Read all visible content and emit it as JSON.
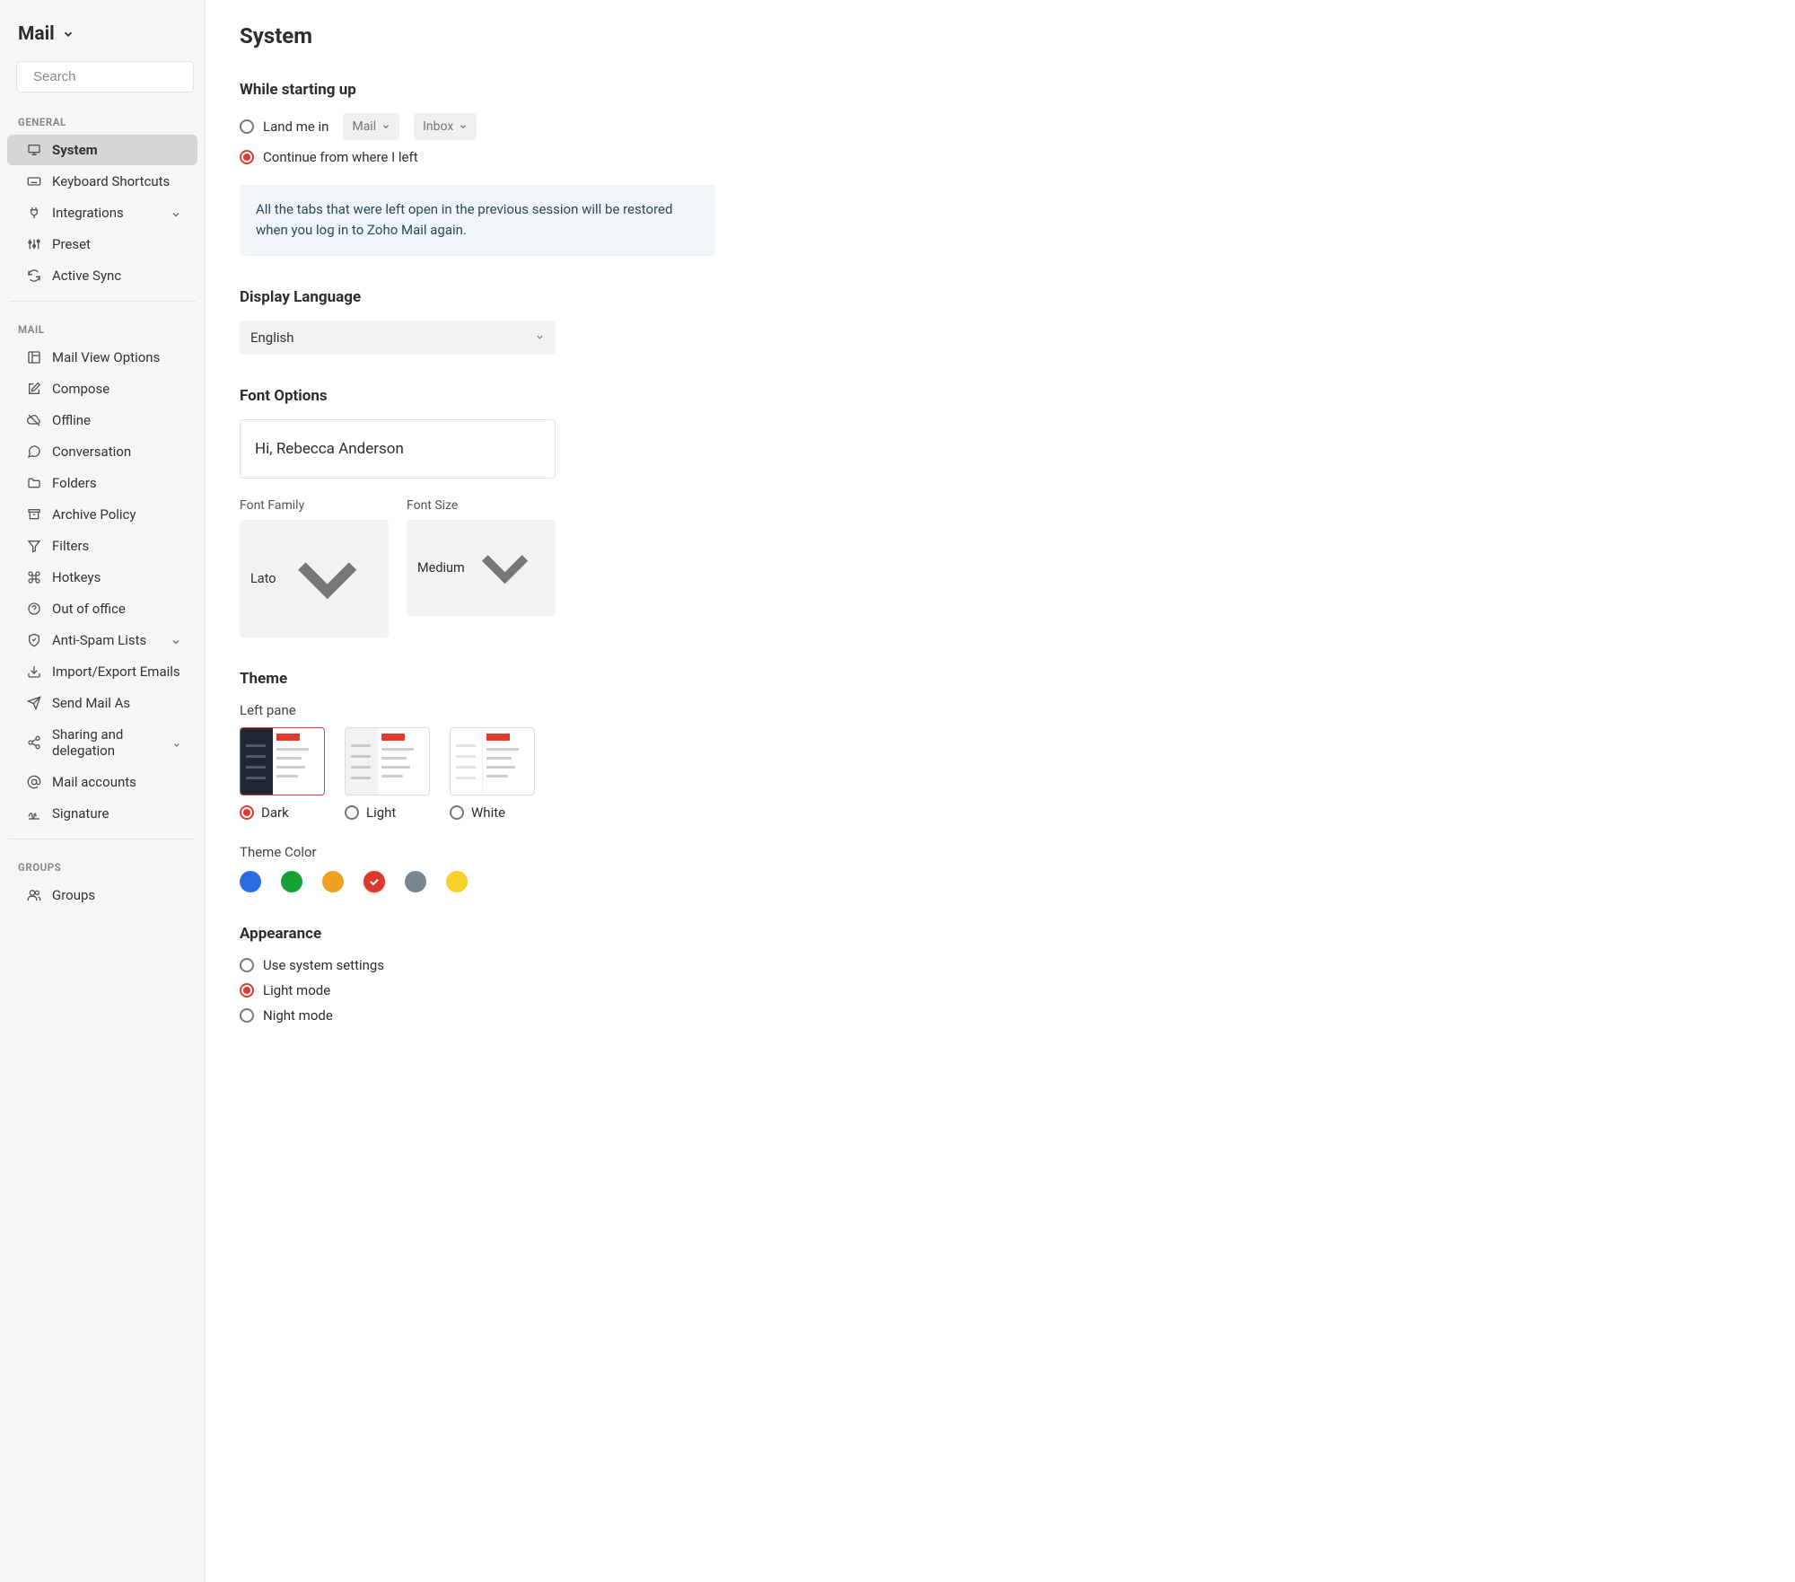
{
  "sidebar": {
    "title": "Mail",
    "search_placeholder": "Search",
    "sections": {
      "general": {
        "label": "GENERAL",
        "items": [
          {
            "label": "System",
            "icon": "monitor-icon",
            "active": true
          },
          {
            "label": "Keyboard Shortcuts",
            "icon": "keyboard-icon"
          },
          {
            "label": "Integrations",
            "icon": "plug-icon",
            "expandable": true
          },
          {
            "label": "Preset",
            "icon": "sliders-icon"
          },
          {
            "label": "Active Sync",
            "icon": "sync-icon"
          }
        ]
      },
      "mail": {
        "label": "MAIL",
        "items": [
          {
            "label": "Mail View Options",
            "icon": "layout-icon"
          },
          {
            "label": "Compose",
            "icon": "edit-icon"
          },
          {
            "label": "Offline",
            "icon": "cloud-off-icon"
          },
          {
            "label": "Conversation",
            "icon": "chat-icon"
          },
          {
            "label": "Folders",
            "icon": "folder-icon"
          },
          {
            "label": "Archive Policy",
            "icon": "archive-icon"
          },
          {
            "label": "Filters",
            "icon": "filter-icon"
          },
          {
            "label": "Hotkeys",
            "icon": "command-icon"
          },
          {
            "label": "Out of office",
            "icon": "away-icon"
          },
          {
            "label": "Anti-Spam Lists",
            "icon": "shield-icon",
            "expandable": true
          },
          {
            "label": "Import/Export Emails",
            "icon": "import-icon"
          },
          {
            "label": "Send Mail As",
            "icon": "send-icon"
          },
          {
            "label": "Sharing and delegation",
            "icon": "share-icon",
            "expandable": true
          },
          {
            "label": "Mail accounts",
            "icon": "at-icon"
          },
          {
            "label": "Signature",
            "icon": "signature-icon"
          }
        ]
      },
      "groups": {
        "label": "GROUPS",
        "items": [
          {
            "label": "Groups",
            "icon": "users-icon"
          }
        ]
      }
    }
  },
  "main": {
    "title": "System",
    "startup": {
      "title": "While starting up",
      "land_label": "Land me in",
      "land_select1": "Mail",
      "land_select2": "Inbox",
      "continue_label": "Continue from where I left",
      "info": "All the tabs that were left open in the previous session will be restored when you log in to Zoho Mail again."
    },
    "language": {
      "title": "Display Language",
      "value": "English"
    },
    "font": {
      "title": "Font Options",
      "preview": "Hi, Rebecca Anderson",
      "family_label": "Font Family",
      "family_value": "Lato",
      "size_label": "Font Size",
      "size_value": "Medium"
    },
    "theme": {
      "title": "Theme",
      "left_pane_label": "Left pane",
      "options": [
        {
          "label": "Dark",
          "selected": true
        },
        {
          "label": "Light",
          "selected": false
        },
        {
          "label": "White",
          "selected": false
        }
      ],
      "color_label": "Theme Color",
      "colors": [
        {
          "hex": "#2b6be4",
          "selected": false
        },
        {
          "hex": "#14a138",
          "selected": false
        },
        {
          "hex": "#f0a020",
          "selected": false
        },
        {
          "hex": "#d93a2b",
          "selected": true
        },
        {
          "hex": "#7b8591",
          "selected": false
        },
        {
          "hex": "#f4d22a",
          "selected": false
        }
      ]
    },
    "appearance": {
      "title": "Appearance",
      "options": [
        {
          "label": "Use system settings",
          "selected": false
        },
        {
          "label": "Light mode",
          "selected": true
        },
        {
          "label": "Night mode",
          "selected": false
        }
      ]
    }
  }
}
